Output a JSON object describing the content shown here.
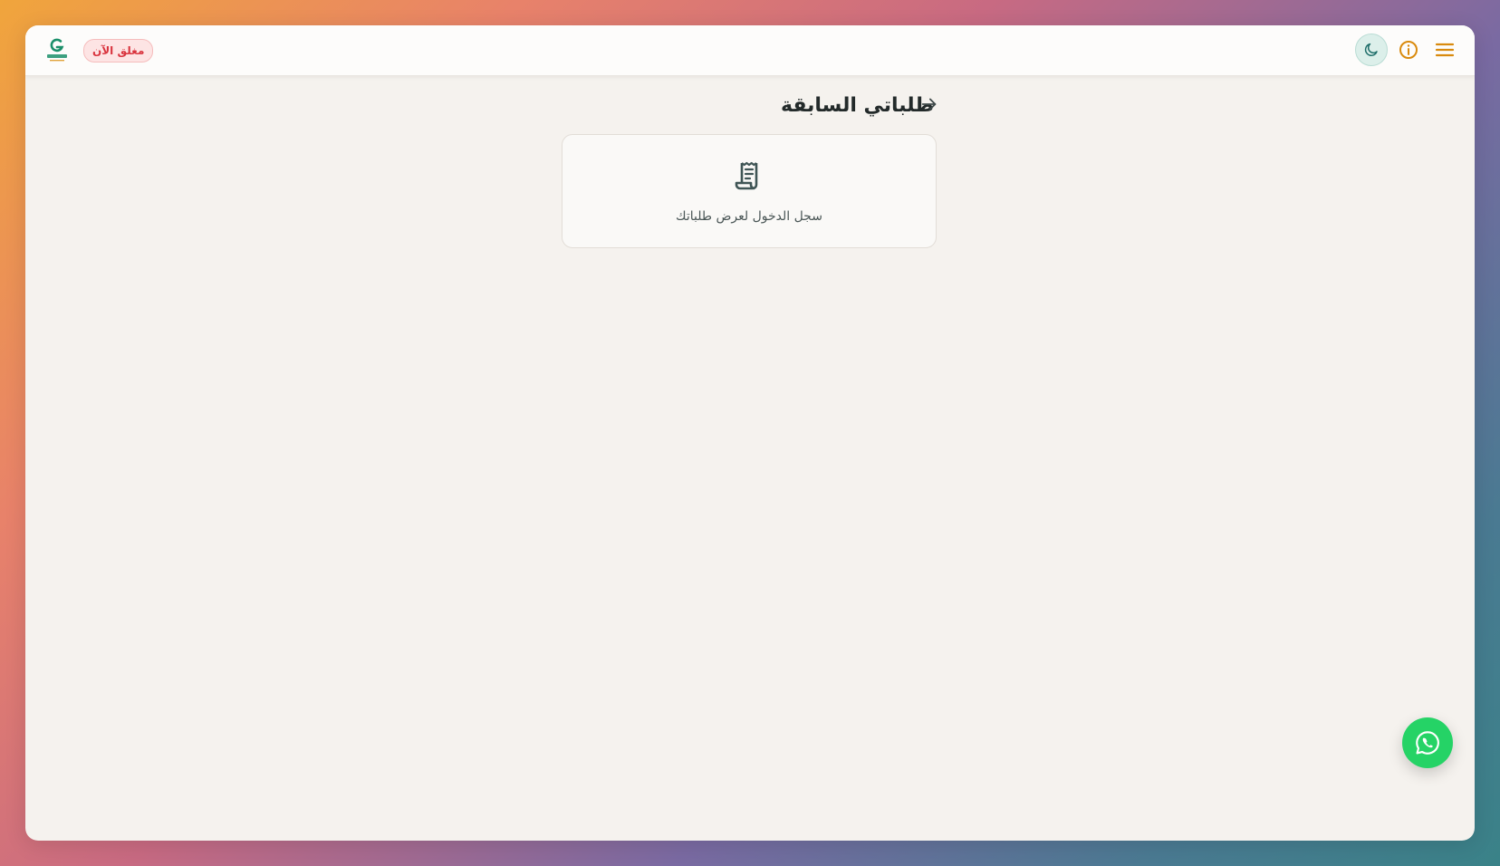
{
  "header": {
    "logo_icon": "geebi-logo",
    "status_badge": "مغلق الآن",
    "status_color": "#d9343e",
    "menu_icon": "hamburger-menu-icon",
    "info_icon": "info-circle-icon",
    "theme_icon": "moon-icon",
    "accent_color": "#d98a0e"
  },
  "main": {
    "title": "طلباتي السابقة",
    "back_icon": "arrow-right-icon",
    "empty_state": {
      "icon": "receipt-icon",
      "message": "سجل الدخول لعرض طلباتك"
    }
  },
  "fab": {
    "icon": "whatsapp-icon",
    "color": "#25d366"
  }
}
